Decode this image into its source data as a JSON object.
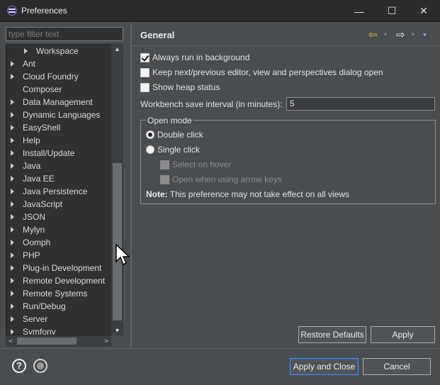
{
  "window": {
    "title": "Preferences",
    "min_glyph": "—",
    "max_glyph": "☐",
    "close_glyph": "✕"
  },
  "sidebar": {
    "filter_placeholder": "type filter text",
    "items": [
      {
        "label": "Workspace",
        "indent": 2,
        "has_children": true
      },
      {
        "label": "Ant",
        "indent": 1,
        "has_children": true
      },
      {
        "label": "Cloud Foundry",
        "indent": 1,
        "has_children": true
      },
      {
        "label": "Composer",
        "indent": 1,
        "has_children": false
      },
      {
        "label": "Data Management",
        "indent": 1,
        "has_children": true
      },
      {
        "label": "Dynamic Languages",
        "indent": 1,
        "has_children": true
      },
      {
        "label": "EasyShell",
        "indent": 1,
        "has_children": true
      },
      {
        "label": "Help",
        "indent": 1,
        "has_children": true
      },
      {
        "label": "Install/Update",
        "indent": 1,
        "has_children": true
      },
      {
        "label": "Java",
        "indent": 1,
        "has_children": true
      },
      {
        "label": "Java EE",
        "indent": 1,
        "has_children": true
      },
      {
        "label": "Java Persistence",
        "indent": 1,
        "has_children": true
      },
      {
        "label": "JavaScript",
        "indent": 1,
        "has_children": true
      },
      {
        "label": "JSON",
        "indent": 1,
        "has_children": true
      },
      {
        "label": "Mylyn",
        "indent": 1,
        "has_children": true
      },
      {
        "label": "Oomph",
        "indent": 1,
        "has_children": true
      },
      {
        "label": "PHP",
        "indent": 1,
        "has_children": true
      },
      {
        "label": "Plug-in Development",
        "indent": 1,
        "has_children": true
      },
      {
        "label": "Remote Development",
        "indent": 1,
        "has_children": true
      },
      {
        "label": "Remote Systems",
        "indent": 1,
        "has_children": true
      },
      {
        "label": "Run/Debug",
        "indent": 1,
        "has_children": true
      },
      {
        "label": "Server",
        "indent": 1,
        "has_children": true
      },
      {
        "label": "Symfony",
        "indent": 1,
        "has_children": true
      }
    ],
    "scroll_up": "▲",
    "scroll_down": "▼",
    "scroll_left": "<",
    "scroll_right": ">"
  },
  "page": {
    "title": "General",
    "nav_back": "⇦",
    "nav_fwd": "⇨",
    "nav_dropdown": "▾",
    "options": {
      "always_run_background": {
        "label": "Always run in background",
        "checked": true
      },
      "keep_next_prev": {
        "label": "Keep next/previous editor, view and perspectives dialog open",
        "checked": false
      },
      "show_heap": {
        "label": "Show heap status",
        "checked": false
      }
    },
    "save_interval_label": "Workbench save interval (in minutes):",
    "save_interval_value": "5",
    "open_mode": {
      "legend": "Open mode",
      "double_click": "Double click",
      "single_click": "Single click",
      "select_on_hover": "Select on hover",
      "open_arrow_keys": "Open when using arrow keys",
      "selected": "double_click"
    },
    "note_label": "Note:",
    "note_text": " This preference may not take effect on all views",
    "restore_defaults": "Restore Defaults",
    "apply": "Apply"
  },
  "footer": {
    "help_glyph": "?",
    "apply_close": "Apply and Close",
    "cancel": "Cancel"
  },
  "colors": {
    "background": "#4a4d50",
    "tree_bg": "#2f3133",
    "accent_border": "#4f8ce0",
    "back_arrow": "#e7b33a"
  }
}
